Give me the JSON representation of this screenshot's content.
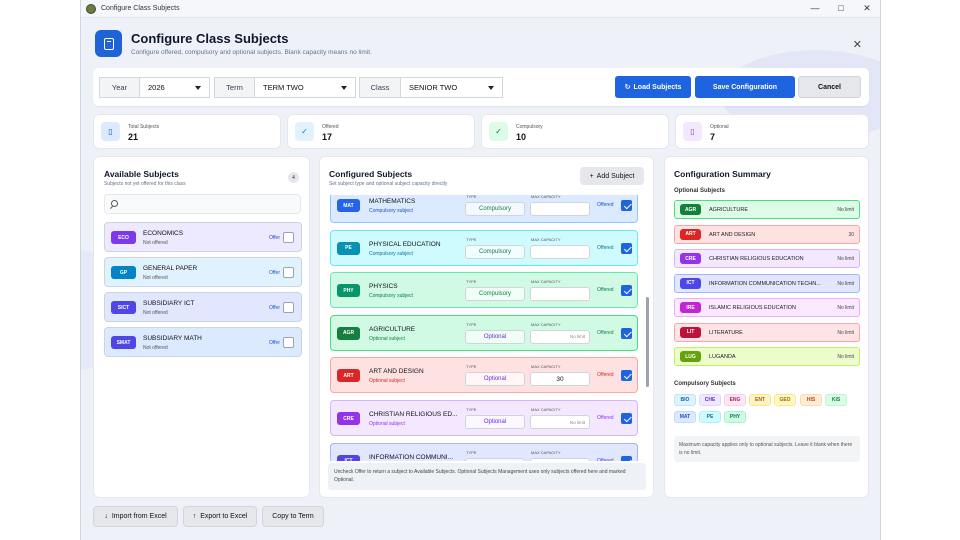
{
  "window": {
    "title": "Configure Class Subjects"
  },
  "header": {
    "title": "Configure Class Subjects",
    "subtitle": "Configure offered, compulsory and optional subjects. Blank capacity means no limit."
  },
  "selectors": {
    "year_label": "Year",
    "year_value": "2026",
    "term_label": "Term",
    "term_value": "TERM TWO",
    "class_label": "Class",
    "class_value": "SENIOR TWO"
  },
  "actions": {
    "load": "Load Subjects",
    "save": "Save Configuration",
    "cancel": "Cancel"
  },
  "stats": [
    {
      "label": "Total Subjects",
      "value": "21"
    },
    {
      "label": "Offered",
      "value": "17"
    },
    {
      "label": "Compulsory",
      "value": "10"
    },
    {
      "label": "Optional",
      "value": "7"
    }
  ],
  "available": {
    "title": "Available Subjects",
    "subtitle": "Subjects not yet offered for this class",
    "count": "4",
    "offer_label": "Offer",
    "items": [
      {
        "code": "ECO",
        "name": "ECONOMICS",
        "status": "Not offered",
        "color": "#7c3aed",
        "bg": "#ede9fe"
      },
      {
        "code": "GP",
        "name": "GENERAL PAPER",
        "status": "Not offered",
        "color": "#0284c7",
        "bg": "#e0f2fe"
      },
      {
        "code": "SICT",
        "name": "SUBSIDIARY ICT",
        "status": "Not offered",
        "color": "#4f46e5",
        "bg": "#e0e7ff"
      },
      {
        "code": "SMAT",
        "name": "SUBSIDIARY MATH",
        "status": "Not offered",
        "color": "#4f46e5",
        "bg": "#dbeafe"
      }
    ]
  },
  "configured": {
    "title": "Configured Subjects",
    "subtitle": "Set subject type and optional subject capacity directly",
    "add_label": "Add Subject",
    "type_label": "TYPE",
    "cap_label": "MAX CAPACITY",
    "items": [
      {
        "code": "MAT",
        "name": "MATHEMATICS",
        "status": "Compulsory subject",
        "type": "Compulsory",
        "cap": "",
        "offered": "Offered",
        "color": "#2563eb",
        "bg": "#dbeafe",
        "border": "#93c5fd",
        "stcolor": "#1d4ed8",
        "typecolor": "#15803d",
        "ofcolor": "#1d4ed8"
      },
      {
        "code": "PE",
        "name": "PHYSICAL EDUCATION",
        "status": "Compulsory subject",
        "type": "Compulsory",
        "cap": "",
        "offered": "Offered",
        "color": "#0891b2",
        "bg": "#cffafe",
        "border": "#67e8f9",
        "stcolor": "#0e7490",
        "typecolor": "#15803d",
        "ofcolor": "#0e7490"
      },
      {
        "code": "PHY",
        "name": "PHYSICS",
        "status": "Compulsory subject",
        "type": "Compulsory",
        "cap": "",
        "offered": "Offered",
        "color": "#059669",
        "bg": "#d1fae5",
        "border": "#6ee7b7",
        "stcolor": "#047857",
        "typecolor": "#15803d",
        "ofcolor": "#047857"
      },
      {
        "code": "AGR",
        "name": "AGRICULTURE",
        "status": "Optional subject",
        "type": "Optional",
        "cap": "No limit",
        "offered": "Offered",
        "color": "#15803d",
        "bg": "#d1fae5",
        "border": "#4ade80",
        "stcolor": "#15803d",
        "typecolor": "#6d28d9",
        "ofcolor": "#15803d"
      },
      {
        "code": "ART",
        "name": "ART AND DESIGN",
        "status": "Optional subject",
        "type": "Optional",
        "cap": "30",
        "offered": "Offered",
        "color": "#dc2626",
        "bg": "#fee2e2",
        "border": "#fca5a5",
        "stcolor": "#dc2626",
        "typecolor": "#6d28d9",
        "ofcolor": "#dc2626"
      },
      {
        "code": "CRE",
        "name": "CHRISTIAN RELIGIOUS ED...",
        "status": "Optional subject",
        "type": "Optional",
        "cap": "No limit",
        "offered": "Offered",
        "color": "#9333ea",
        "bg": "#f3e8ff",
        "border": "#d8b4fe",
        "stcolor": "#9333ea",
        "typecolor": "#6d28d9",
        "ofcolor": "#9333ea"
      },
      {
        "code": "ICT",
        "name": "INFORMATION COMMUNI...",
        "status": "Optional subject",
        "type": "Optional",
        "cap": "No limit",
        "offered": "Offered",
        "color": "#4f46e5",
        "bg": "#e0e7ff",
        "border": "#a5b4fc",
        "stcolor": "#4f46e5",
        "typecolor": "#6d28d9",
        "ofcolor": "#4f46e5"
      }
    ],
    "note": "Uncheck Offer to return a subject to Available Subjects. Optional Subjects Management uses only subjects offered here and marked Optional."
  },
  "summary": {
    "title": "Configuration Summary",
    "optional_title": "Optional Subjects",
    "optional": [
      {
        "code": "AGR",
        "name": "AGRICULTURE",
        "limit": "No limit",
        "color": "#15803d",
        "bg": "#dcfce7",
        "border": "#4ade80"
      },
      {
        "code": "ART",
        "name": "ART AND DESIGN",
        "limit": "30",
        "color": "#dc2626",
        "bg": "#fee2e2",
        "border": "#fca5a5"
      },
      {
        "code": "CRE",
        "name": "CHRISTIAN RELIGIOUS EDUCATION",
        "limit": "No limit",
        "color": "#9333ea",
        "bg": "#f3e8ff",
        "border": "#d8b4fe"
      },
      {
        "code": "ICT",
        "name": "INFORMATION COMMUNICATION TECHN...",
        "limit": "No limit",
        "color": "#4f46e5",
        "bg": "#e0e7ff",
        "border": "#a5b4fc"
      },
      {
        "code": "IRE",
        "name": "ISLAMIC RELIGIOUS EDUCATION",
        "limit": "No limit",
        "color": "#c026d3",
        "bg": "#fae8ff",
        "border": "#f0abfc"
      },
      {
        "code": "LIT",
        "name": "LITERATURE",
        "limit": "No limit",
        "color": "#be123c",
        "bg": "#ffe4e6",
        "border": "#fda4af"
      },
      {
        "code": "LUG",
        "name": "LUGANDA",
        "limit": "No limit",
        "color": "#65a30d",
        "bg": "#ecfccb",
        "border": "#bef264"
      }
    ],
    "compulsory_title": "Compulsory Subjects",
    "compulsory": [
      {
        "code": "BIO",
        "color": "#0369a1",
        "bg": "#e0f2fe",
        "border": "#bae6fd"
      },
      {
        "code": "CHE",
        "color": "#6d28d9",
        "bg": "#ede9fe",
        "border": "#ddd6fe"
      },
      {
        "code": "ENG",
        "color": "#be185d",
        "bg": "#fce7f3",
        "border": "#fbcfe8"
      },
      {
        "code": "ENT",
        "color": "#a16207",
        "bg": "#fef3c7",
        "border": "#fde68a"
      },
      {
        "code": "GEO",
        "color": "#a16207",
        "bg": "#fef9c3",
        "border": "#fde68a"
      },
      {
        "code": "HIS",
        "color": "#c2410c",
        "bg": "#ffedd5",
        "border": "#fed7aa"
      },
      {
        "code": "KIS",
        "color": "#15803d",
        "bg": "#dcfce7",
        "border": "#bbf7d0"
      },
      {
        "code": "MAT",
        "color": "#1d4ed8",
        "bg": "#dbeafe",
        "border": "#bfdbfe"
      },
      {
        "code": "PE",
        "color": "#0e7490",
        "bg": "#cffafe",
        "border": "#a5f3fc"
      },
      {
        "code": "PHY",
        "color": "#047857",
        "bg": "#d1fae5",
        "border": "#a7f3d0"
      }
    ],
    "note": "Maximum capacity applies only to optional subjects. Leave it blank when there is no limit."
  },
  "footer": {
    "import": "Import from Excel",
    "export": "Export to Excel",
    "copy": "Copy to Term"
  },
  "colors": {
    "accent": "#1e63e0"
  }
}
